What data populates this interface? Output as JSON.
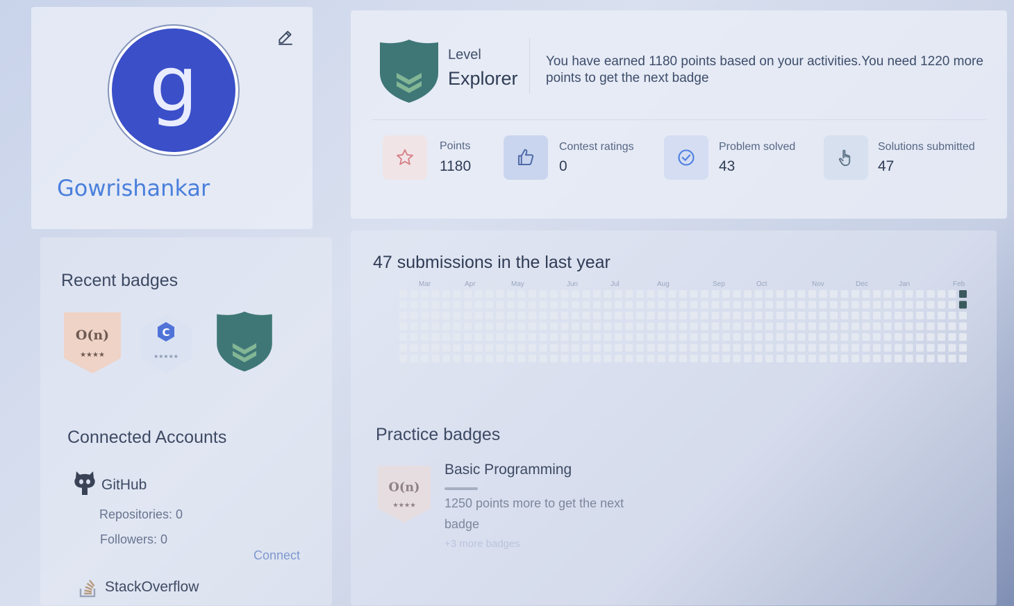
{
  "profile": {
    "avatar_letter": "g",
    "username": "Gowrishankar"
  },
  "level": {
    "label": "Level",
    "value": "Explorer",
    "message": "You have earned 1180 points based on your activities.You need 1220 more points to get the next badge"
  },
  "stats": [
    {
      "label": "Points",
      "value": "1180",
      "icon": "star-icon"
    },
    {
      "label": "Contest ratings",
      "value": "0",
      "icon": "thumbs-up-icon"
    },
    {
      "label": "Problem solved",
      "value": "43",
      "icon": "check-circle-icon"
    },
    {
      "label": "Solutions submitted",
      "value": "47",
      "icon": "hand-pointer-icon"
    }
  ],
  "recent_badges": {
    "title": "Recent badges",
    "items": [
      {
        "text": "O(n)",
        "stars": "★★★★",
        "icon": "complexity-badge-icon"
      },
      {
        "text": "C",
        "stars": "★★★★★",
        "icon": "c-language-badge-icon"
      },
      {
        "text": "",
        "stars": "",
        "icon": "explorer-shield-icon"
      }
    ]
  },
  "activity": {
    "title": "47 submissions in the last year",
    "months": [
      "Mar",
      "Apr",
      "May",
      "Jun",
      "Jul",
      "Aug",
      "Sep",
      "Oct",
      "Nov",
      "Dec",
      "Jan",
      "Feb"
    ]
  },
  "connected_accounts": {
    "title": "Connected Accounts",
    "github": {
      "name": "GitHub",
      "repositories": "Repositories: 0",
      "followers": "Followers: 0",
      "connect_label": "Connect"
    },
    "stackoverflow": {
      "name": "StackOverflow"
    }
  },
  "practice_badges": {
    "title": "Practice badges",
    "badge_text": "O(n)",
    "badge_stars": "★★★★",
    "name": "Basic Programming",
    "message": "1250 points more to get the next badge",
    "more": "+3 more badges"
  },
  "colors": {
    "accent": "#4a7fdc",
    "avatar_bg": "#3a4fc8",
    "shield": "#3f7777",
    "heat_empty": "#e4e8f1",
    "heat_active": "#3b5a5e"
  }
}
